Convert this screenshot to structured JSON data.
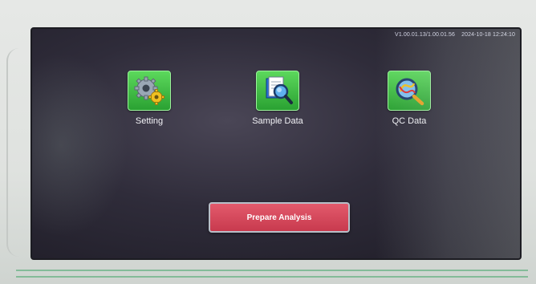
{
  "status_bar": {
    "version": "V1.00.01.13/1.00.01.56",
    "datetime": "2024-10-18 12:24:10"
  },
  "menu": {
    "setting": {
      "label": "Setting",
      "icon": "gears-icon"
    },
    "sample_data": {
      "label": "Sample Data",
      "icon": "magnifier-document-icon"
    },
    "qc_data": {
      "label": "QC Data",
      "icon": "qc-magnifier-icon"
    }
  },
  "actions": {
    "prepare_label": "Prepare Analysis"
  },
  "colors": {
    "tile_green": "#2aa132",
    "prepare_red": "#d44a5d"
  }
}
